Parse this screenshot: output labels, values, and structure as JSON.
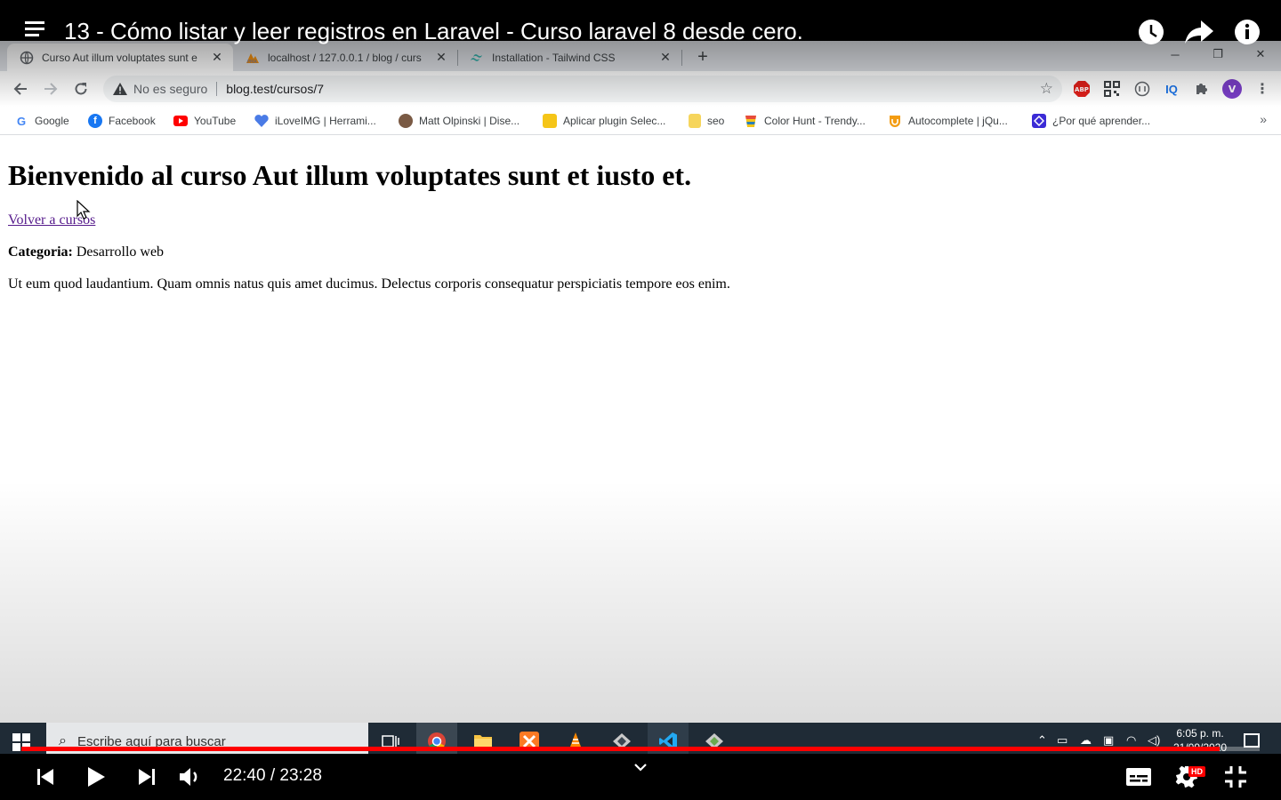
{
  "video": {
    "title": "13 - Cómo listar y leer registros en Laravel - Curso laravel 8 desde cero.",
    "current_time": "22:40",
    "duration": "23:28",
    "time_display": "22:40 / 23:28",
    "progress": 0.9679,
    "hd_label": "HD"
  },
  "browser": {
    "tabs": [
      {
        "title": "Curso Aut illum voluptates sunt e",
        "icon": "globe-icon",
        "active": true
      },
      {
        "title": "localhost / 127.0.0.1 / blog / curs",
        "icon": "phpmyadmin-icon",
        "active": false
      },
      {
        "title": "Installation - Tailwind CSS",
        "icon": "tailwind-icon",
        "active": false
      }
    ],
    "omnibox": {
      "security_text": "No es seguro",
      "url": "blog.test/cursos/7"
    },
    "extensions": [
      {
        "name": "adblock-icon",
        "label": "ABP",
        "color": "#e0201b"
      },
      {
        "name": "qr-code-icon",
        "label": "",
        "color": "#3c4043"
      },
      {
        "name": "readme-icon",
        "label": "",
        "color": "#5f6368"
      },
      {
        "name": "iq-icon",
        "label": "IQ",
        "color": "#1a73e8"
      },
      {
        "name": "puzzle-icon",
        "label": "",
        "color": "#5f6368"
      },
      {
        "name": "profile-avatar",
        "label": "V",
        "color": "#7b3fc8"
      }
    ],
    "bookmarks": [
      {
        "label": "Google",
        "icon": "google-icon",
        "color": "#4285f4"
      },
      {
        "label": "Facebook",
        "icon": "facebook-icon",
        "color": "#1877f2"
      },
      {
        "label": "YouTube",
        "icon": "youtube-icon",
        "color": "#ff0000"
      },
      {
        "label": "iLoveIMG | Herrami...",
        "icon": "iloveimg-icon",
        "color": "#4a7be6"
      },
      {
        "label": "Matt Olpinski | Dise...",
        "icon": "avatar-icon",
        "color": "#7a5a44"
      },
      {
        "label": "Aplicar plugin Selec...",
        "icon": "bookmark-folder-icon",
        "color": "#f5c518"
      },
      {
        "label": "seo",
        "icon": "folder-icon",
        "color": "#f6d55c"
      },
      {
        "label": "Color Hunt - Trendy...",
        "icon": "colorhunt-icon",
        "color": "#e74c3c"
      },
      {
        "label": "Autocomplete | jQu...",
        "icon": "autocomplete-icon",
        "color": "#f39c12"
      },
      {
        "label": "¿Por qué aprender...",
        "icon": "platzi-icon",
        "color": "#3b2bd6"
      }
    ]
  },
  "page": {
    "heading": "Bienvenido al curso Aut illum voluptates sunt et iusto et.",
    "back_link": "Volver a cursos",
    "category_label": "Categoria:",
    "category_value": "Desarrollo web",
    "description": "Ut eum quod laudantium. Quam omnis natus quis amet ducimus. Delectus corporis consequatur perspiciatis tempore eos enim."
  },
  "taskbar": {
    "search_placeholder": "Escribe aquí para buscar",
    "time": "6:05 p. m.",
    "date": "21/09/2020",
    "apps": [
      "task-view-icon",
      "chrome-icon",
      "file-explorer-icon",
      "xampp-icon",
      "vlc-icon",
      "app-icon",
      "vscode-icon",
      "app-icon"
    ]
  }
}
